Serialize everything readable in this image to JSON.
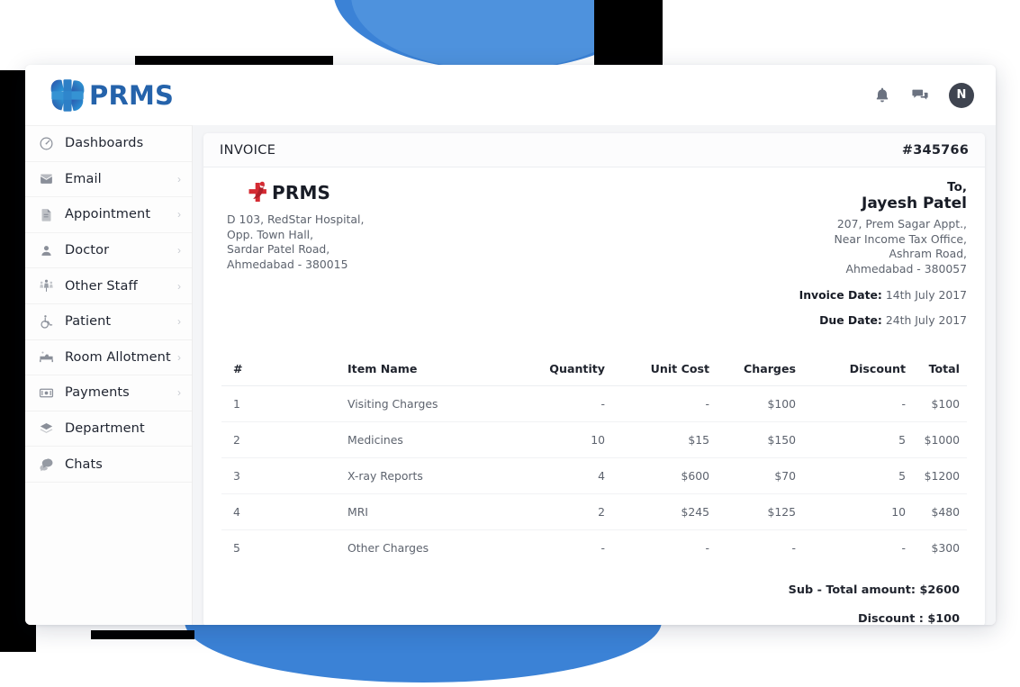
{
  "window": {
    "brand_name": "PRMS",
    "brand_logo_icon": "prms-cross-logo-icon"
  },
  "topbar": {
    "notifications_icon": "bell-icon",
    "messages_icon": "chat-icon",
    "avatar_initial": "N"
  },
  "sidebar": {
    "items": [
      {
        "label": "Dashboards",
        "icon": "speedometer-icon",
        "has_chevron": false
      },
      {
        "label": "Email",
        "icon": "envelope-icon",
        "has_chevron": true
      },
      {
        "label": "Appointment",
        "icon": "document-icon",
        "has_chevron": true
      },
      {
        "label": "Doctor",
        "icon": "user-icon",
        "has_chevron": true
      },
      {
        "label": "Other Staff",
        "icon": "staff-group-icon",
        "has_chevron": true
      },
      {
        "label": "Patient",
        "icon": "wheelchair-icon",
        "has_chevron": true
      },
      {
        "label": "Room Allotment",
        "icon": "hospital-bed-icon",
        "has_chevron": true
      },
      {
        "label": "Payments",
        "icon": "banknote-icon",
        "has_chevron": true
      },
      {
        "label": "Department",
        "icon": "layers-icon",
        "has_chevron": false
      },
      {
        "label": "Chats",
        "icon": "chat-bubbles-icon",
        "has_chevron": false
      }
    ],
    "chevron_glyph": "›"
  },
  "invoice": {
    "header_title": "INVOICE",
    "invoice_number": "#345766",
    "company": {
      "logo_icon": "prms-red-cross-logo-icon",
      "logo_text": "PRMS",
      "address": [
        "D 103, RedStar Hospital,",
        "Opp. Town Hall,",
        "Sardar Patel Road,",
        "Ahmedabad - 380015"
      ]
    },
    "bill_to": {
      "to_label": "To,",
      "name": "Jayesh Patel",
      "address": [
        "207, Prem Sagar Appt.,",
        "Near Income Tax Office,",
        "Ashram Road,",
        "Ahmedabad - 380057"
      ],
      "invoice_date_label": "Invoice Date:",
      "invoice_date": "14th July 2017",
      "due_date_label": "Due Date:",
      "due_date": "24th July 2017"
    },
    "table": {
      "columns": [
        "#",
        "Item Name",
        "Quantity",
        "Unit Cost",
        "Charges",
        "Discount",
        "Total"
      ],
      "rows": [
        {
          "idx": "1",
          "item": "Visiting Charges",
          "qty": "-",
          "unit": "-",
          "charges": "$100",
          "discount": "-",
          "total": "$100"
        },
        {
          "idx": "2",
          "item": "Medicines",
          "qty": "10",
          "unit": "$15",
          "charges": "$150",
          "discount": "5",
          "total": "$1000"
        },
        {
          "idx": "3",
          "item": "X-ray Reports",
          "qty": "4",
          "unit": "$600",
          "charges": "$70",
          "discount": "5",
          "total": "$1200"
        },
        {
          "idx": "4",
          "item": "MRI",
          "qty": "2",
          "unit": "$245",
          "charges": "$125",
          "discount": "10",
          "total": "$480"
        },
        {
          "idx": "5",
          "item": "Other Charges",
          "qty": "-",
          "unit": "-",
          "charges": "-",
          "discount": "-",
          "total": "$300"
        }
      ]
    },
    "totals": {
      "subtotal_label": "Sub - Total amount:",
      "subtotal_value": "$2600",
      "discount_label": "Discount :",
      "discount_value": "$100"
    }
  },
  "colors": {
    "brand_blue": "#2563ab",
    "decor_blue": "#3b82d6",
    "logo_red": "#d52b33",
    "content_bg": "#f4f5f7"
  }
}
